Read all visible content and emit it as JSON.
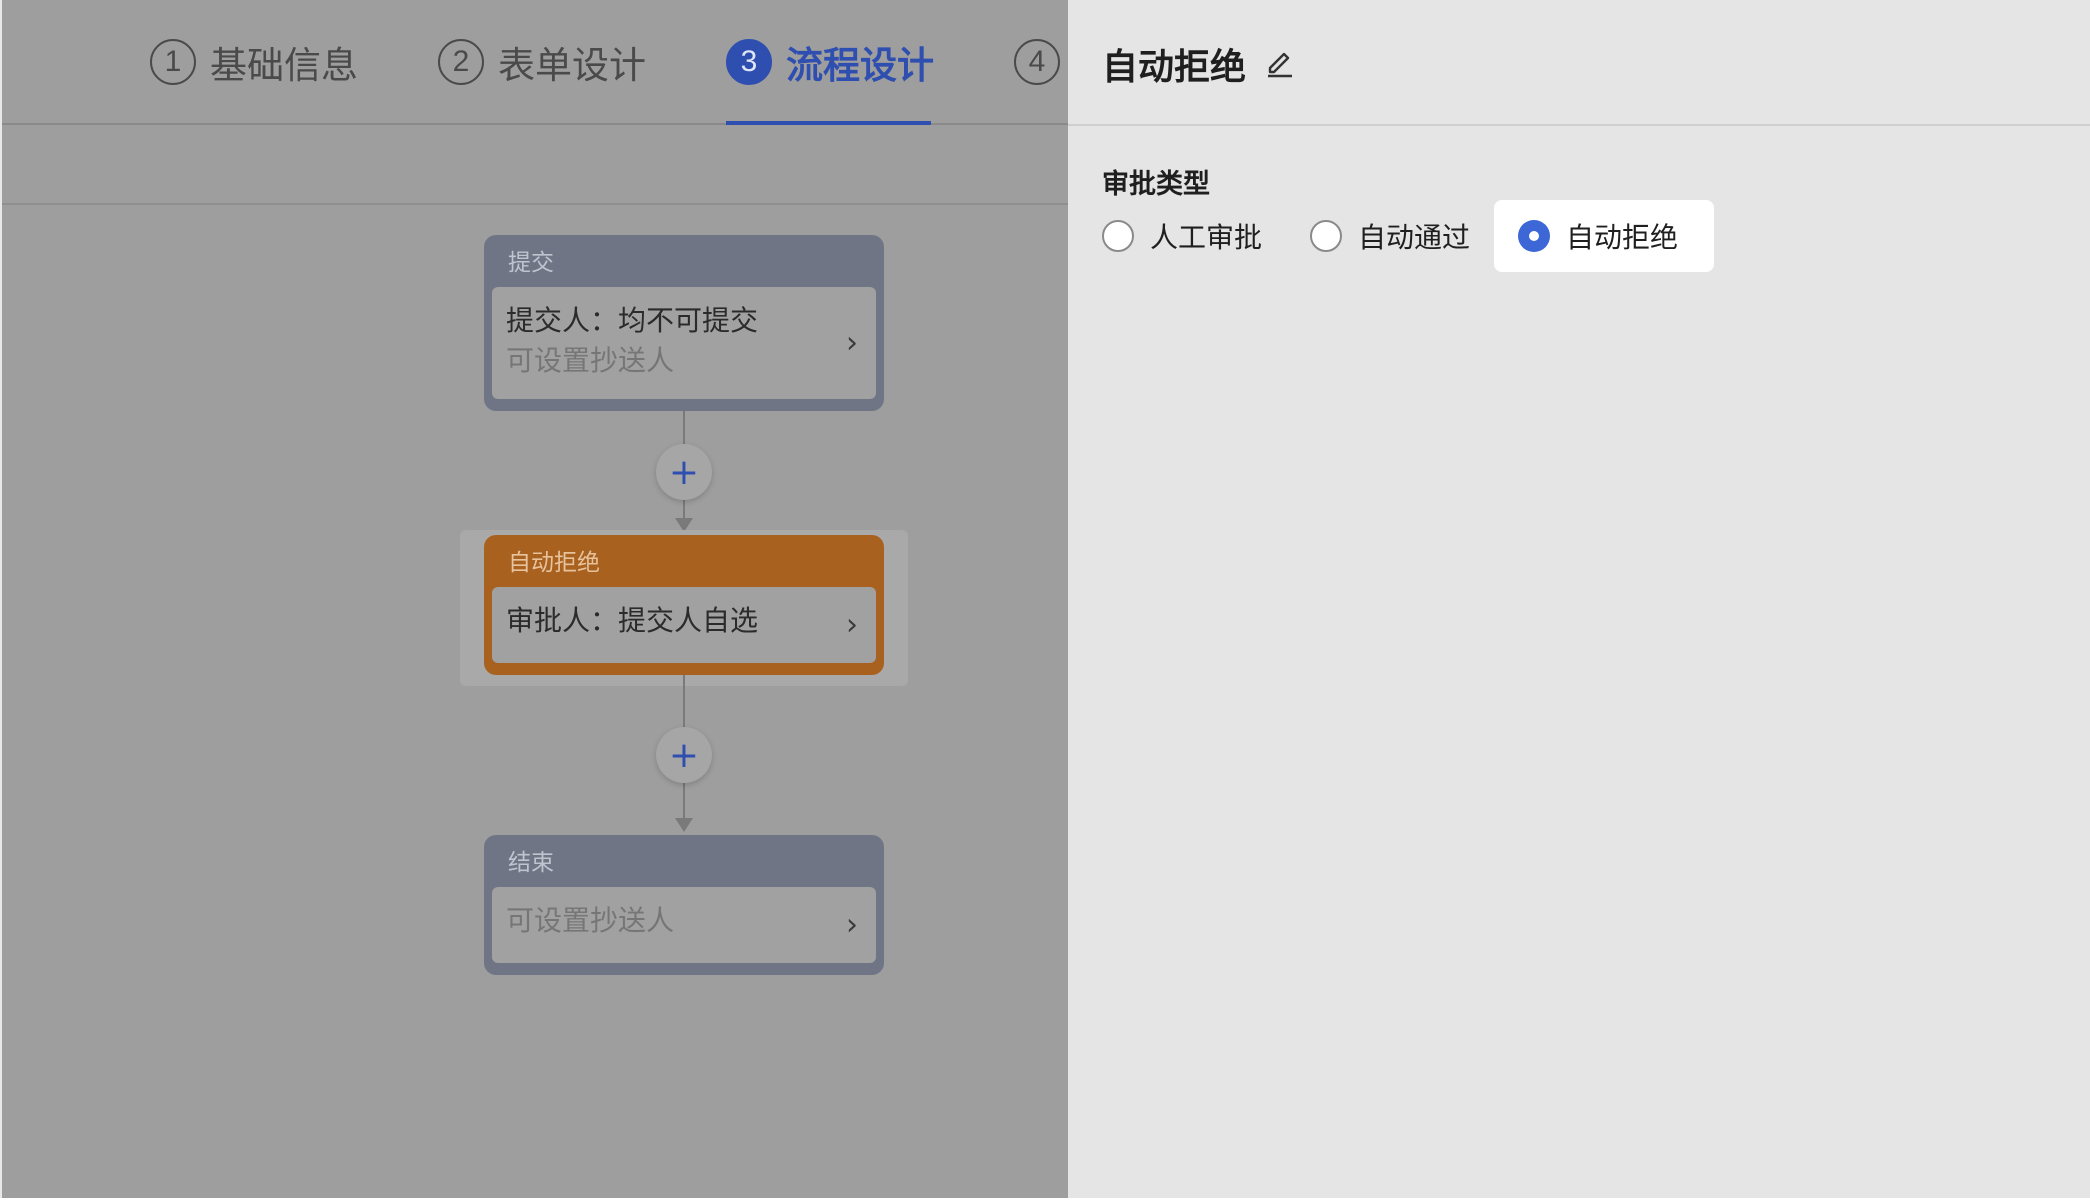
{
  "steps": [
    {
      "num": "1",
      "label": "基础信息"
    },
    {
      "num": "2",
      "label": "表单设计"
    },
    {
      "num": "3",
      "label": "流程设计"
    },
    {
      "num": "4",
      "label": ""
    }
  ],
  "flow": {
    "submit": {
      "header": "提交",
      "line1": "提交人：均不可提交",
      "line2": "可设置抄送人"
    },
    "reject": {
      "header": "自动拒绝",
      "line1": "审批人：提交人自选"
    },
    "end": {
      "header": "结束",
      "line2": "可设置抄送人"
    },
    "add_symbol": "+",
    "chevron": "›"
  },
  "drawer": {
    "title": "自动拒绝",
    "section_label": "审批类型",
    "options": [
      {
        "label": "人工审批",
        "selected": false
      },
      {
        "label": "自动通过",
        "selected": false
      },
      {
        "label": "自动拒绝",
        "selected": true
      }
    ]
  },
  "colors": {
    "accent": "#2f4fb0",
    "radio_selected": "#3d66d6",
    "reject_node": "#a8611f",
    "node": "#6f7585"
  },
  "icons": [
    "edit-pencil-icon",
    "chevron-right-icon",
    "plus-icon"
  ]
}
